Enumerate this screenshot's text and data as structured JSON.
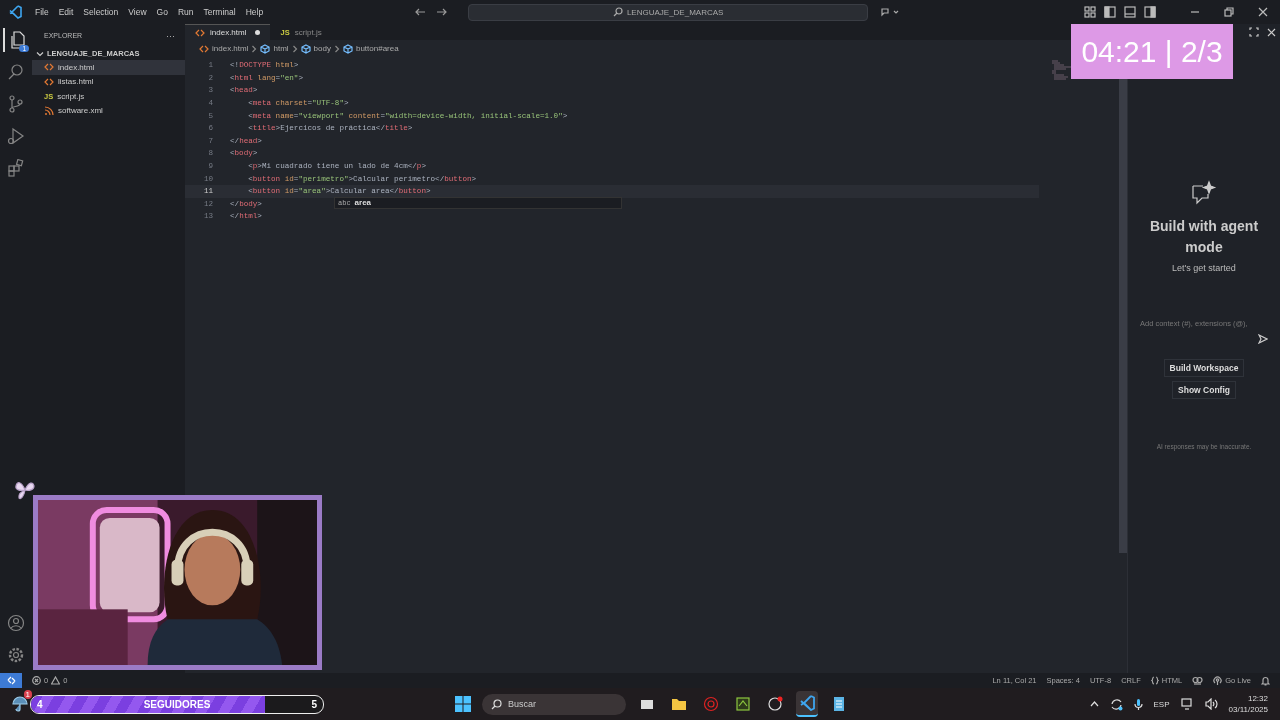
{
  "title_bar": {
    "menu": [
      "File",
      "Edit",
      "Selection",
      "View",
      "Go",
      "Run",
      "Terminal",
      "Help"
    ],
    "search": "LENGUAJE_DE_MARCAS"
  },
  "activity_bar": {
    "badge": "1"
  },
  "explorer": {
    "title": "EXPLORER",
    "more": "···",
    "folder": "LENGUAJE_DE_MARCAS",
    "expanded": true,
    "files": [
      {
        "name": "index.html",
        "kind": "html",
        "selected": true
      },
      {
        "name": "listas.html",
        "kind": "html",
        "selected": false
      },
      {
        "name": "script.js",
        "kind": "js",
        "icon_label": "JS",
        "selected": false
      },
      {
        "name": "software.xml",
        "kind": "xml",
        "selected": false
      }
    ]
  },
  "tabs": [
    {
      "label": "index.html",
      "kind": "html",
      "selected": true,
      "modified": true
    },
    {
      "label": "script.js",
      "kind": "js",
      "icon_label": "JS",
      "selected": false,
      "modified": false
    }
  ],
  "breadcrumb": [
    "index.html",
    "html",
    "body",
    "button#area"
  ],
  "editor": {
    "lines": [
      {
        "number": "1",
        "current": false,
        "tokens": [
          {
            "kind": "punct",
            "text": "<!"
          },
          {
            "kind": "tag",
            "text": "DOCTYPE"
          },
          {
            "kind": "attr",
            "text": " html"
          },
          {
            "kind": "punct",
            "text": ">"
          }
        ]
      },
      {
        "number": "2",
        "current": false,
        "tokens": [
          {
            "kind": "punct",
            "text": "<"
          },
          {
            "kind": "tag",
            "text": "html"
          },
          {
            "kind": "attr",
            "text": " lang"
          },
          {
            "kind": "punct",
            "text": "="
          },
          {
            "kind": "string",
            "text": "\"en\""
          },
          {
            "kind": "punct",
            "text": ">"
          }
        ]
      },
      {
        "number": "3",
        "current": false,
        "tokens": [
          {
            "kind": "punct",
            "text": "<"
          },
          {
            "kind": "tag",
            "text": "head"
          },
          {
            "kind": "punct",
            "text": ">"
          }
        ]
      },
      {
        "number": "4",
        "current": false,
        "tokens": [
          {
            "kind": "punct",
            "text": "    <"
          },
          {
            "kind": "tag",
            "text": "meta"
          },
          {
            "kind": "attr",
            "text": " charset"
          },
          {
            "kind": "punct",
            "text": "="
          },
          {
            "kind": "string",
            "text": "\"UTF-8\""
          },
          {
            "kind": "punct",
            "text": ">"
          }
        ]
      },
      {
        "number": "5",
        "current": false,
        "tokens": [
          {
            "kind": "punct",
            "text": "    <"
          },
          {
            "kind": "tag",
            "text": "meta"
          },
          {
            "kind": "attr",
            "text": " name"
          },
          {
            "kind": "punct",
            "text": "="
          },
          {
            "kind": "string",
            "text": "\"viewport\""
          },
          {
            "kind": "attr",
            "text": " content"
          },
          {
            "kind": "punct",
            "text": "="
          },
          {
            "kind": "string",
            "text": "\"width=device-width, initial-scale=1.0\""
          },
          {
            "kind": "punct",
            "text": ">"
          }
        ]
      },
      {
        "number": "6",
        "current": false,
        "tokens": [
          {
            "kind": "punct",
            "text": "    <"
          },
          {
            "kind": "tag",
            "text": "title"
          },
          {
            "kind": "punct",
            "text": ">Ejercicos de práctica</"
          },
          {
            "kind": "tag",
            "text": "title"
          },
          {
            "kind": "punct",
            "text": ">"
          }
        ]
      },
      {
        "number": "7",
        "current": false,
        "tokens": [
          {
            "kind": "punct",
            "text": "</"
          },
          {
            "kind": "tag",
            "text": "head"
          },
          {
            "kind": "punct",
            "text": ">"
          }
        ]
      },
      {
        "number": "8",
        "current": false,
        "tokens": [
          {
            "kind": "punct",
            "text": "<"
          },
          {
            "kind": "tag",
            "text": "body"
          },
          {
            "kind": "punct",
            "text": ">"
          }
        ]
      },
      {
        "number": "9",
        "current": false,
        "tokens": [
          {
            "kind": "punct",
            "text": "    <"
          },
          {
            "kind": "tag",
            "text": "p"
          },
          {
            "kind": "punct",
            "text": ">Mi cuadrado tiene un lado de 4cm</"
          },
          {
            "kind": "tag",
            "text": "p"
          },
          {
            "kind": "punct",
            "text": ">"
          }
        ]
      },
      {
        "number": "10",
        "current": false,
        "tokens": [
          {
            "kind": "punct",
            "text": "    <"
          },
          {
            "kind": "tag",
            "text": "button"
          },
          {
            "kind": "attr",
            "text": " id"
          },
          {
            "kind": "punct",
            "text": "="
          },
          {
            "kind": "string",
            "text": "\"perimetro\""
          },
          {
            "kind": "punct",
            "text": ">Calcular perimetro</"
          },
          {
            "kind": "tag",
            "text": "button"
          },
          {
            "kind": "punct",
            "text": ">"
          }
        ]
      },
      {
        "number": "11",
        "current": true,
        "tokens": [
          {
            "kind": "punct",
            "text": "    <"
          },
          {
            "kind": "tag",
            "text": "button"
          },
          {
            "kind": "attr",
            "text": " id"
          },
          {
            "kind": "punct",
            "text": "="
          },
          {
            "kind": "string",
            "text": "\"area\""
          },
          {
            "kind": "punct",
            "text": ">Calcular area</"
          },
          {
            "kind": "tag",
            "text": "button"
          },
          {
            "kind": "punct",
            "text": ">"
          }
        ]
      },
      {
        "number": "12",
        "current": false,
        "tokens": [
          {
            "kind": "punct",
            "text": "</"
          },
          {
            "kind": "tag",
            "text": "body"
          },
          {
            "kind": "punct",
            "text": ">"
          }
        ]
      },
      {
        "number": "13",
        "current": false,
        "tokens": [
          {
            "kind": "punct",
            "text": "</"
          },
          {
            "kind": "tag",
            "text": "html"
          },
          {
            "kind": "punct",
            "text": ">"
          }
        ]
      }
    ],
    "suggestion": {
      "type_label": "abc",
      "label": "area"
    }
  },
  "chat": {
    "title": "Build with agent mode",
    "subtitle": "Let's get started",
    "placeholder": "Add context (#), extensions (@),",
    "buttons": [
      "Build Workspace",
      "Show Config"
    ],
    "footer": "AI responses may be inaccurate."
  },
  "timer": "04:21 | 2/3",
  "status_bar": {
    "errors": "0",
    "warnings": "0",
    "items": [
      "Ln 11, Col 21",
      "Spaces: 4",
      "UTF-8",
      "CRLF"
    ],
    "language": "HTML",
    "live": "Go Live"
  },
  "followers": {
    "current": "4",
    "label": "SEGUIDORES",
    "goal": "5",
    "level": 0.8
  },
  "taskbar": {
    "weather_badge": "1",
    "search_placeholder": "Buscar",
    "language": "ESP",
    "time": "12:32",
    "date": "03/11/2025"
  }
}
